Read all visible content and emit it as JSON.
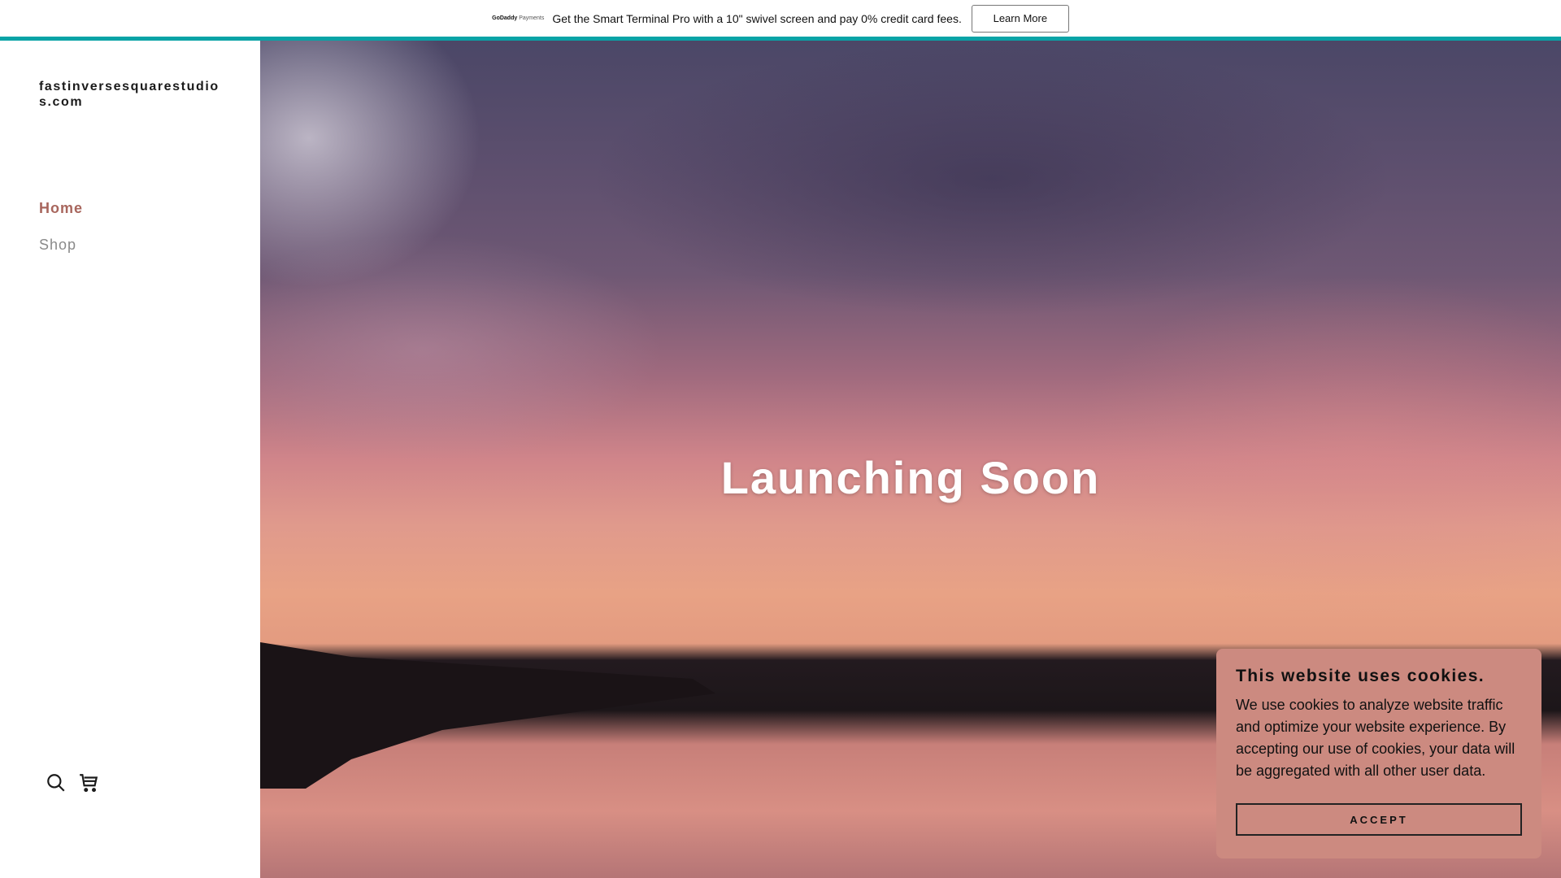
{
  "banner": {
    "logo_text": "GoDaddy Payments",
    "logo_brand": "GoDaddy",
    "logo_suffix": "Payments",
    "message": "Get the Smart Terminal Pro with a 10\" swivel screen and pay 0% credit card fees.",
    "cta_label": "Learn More"
  },
  "sidebar": {
    "site_title": "fastinversesquarestudios.com",
    "nav": [
      {
        "label": "Home",
        "active": true
      },
      {
        "label": "Shop",
        "active": false
      }
    ],
    "icons": [
      "search-icon",
      "cart-icon"
    ]
  },
  "hero": {
    "headline": "Launching Soon"
  },
  "cookie_banner": {
    "title": "This website uses cookies.",
    "body": "We use cookies to analyze website traffic and optimize your website experience. By accepting our use of cookies, your data will be aggregated with all other user data.",
    "accept_label": "ACCEPT"
  },
  "colors": {
    "accent_bar": "#09a3a6",
    "nav_active": "#a8665d",
    "cookie_bg": "#cc8a80"
  }
}
